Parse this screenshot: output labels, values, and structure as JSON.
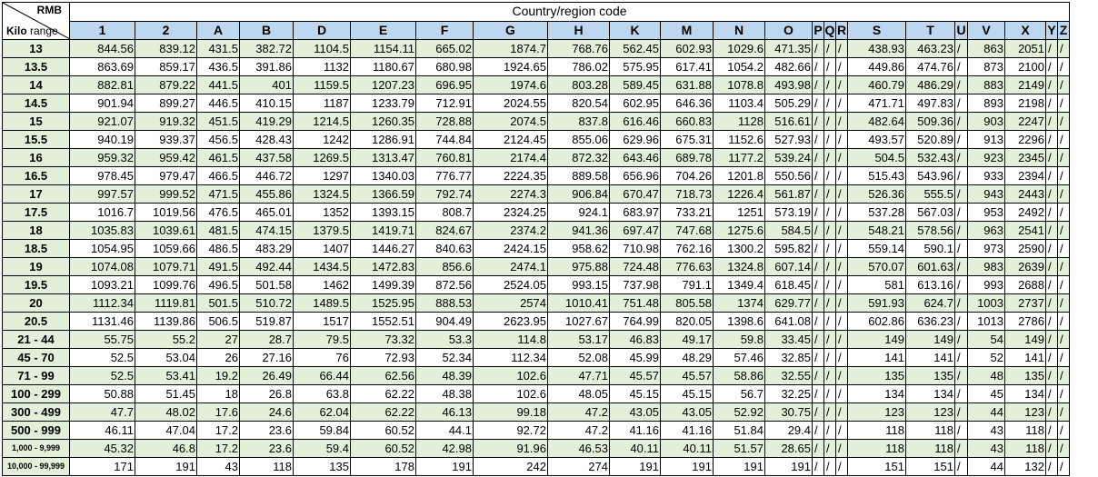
{
  "table": {
    "corner_top": "RMB",
    "corner_bottom_bold": "Kilo",
    "corner_bottom_normal": " range",
    "title": "Country/region code",
    "columns": [
      "1",
      "2",
      "A",
      "B",
      "D",
      "E",
      "F",
      "G",
      "H",
      "K",
      "M",
      "N",
      "O",
      "P",
      "Q",
      "R",
      "S",
      "T",
      "U",
      "V",
      "X",
      "Y",
      "Z"
    ],
    "rows": [
      {
        "label": "13",
        "cells": [
          "844.56",
          "839.12",
          "431.5",
          "382.72",
          "1104.5",
          "1154.11",
          "665.02",
          "1874.7",
          "768.76",
          "562.45",
          "602.93",
          "1029.6",
          "471.35",
          "/",
          "/",
          "/",
          "438.93",
          "463.23",
          "/",
          "863",
          "2051",
          "/",
          "/"
        ]
      },
      {
        "label": "13.5",
        "cells": [
          "863.69",
          "859.17",
          "436.5",
          "391.86",
          "1132",
          "1180.67",
          "680.98",
          "1924.65",
          "786.02",
          "575.95",
          "617.41",
          "1054.2",
          "482.66",
          "/",
          "/",
          "/",
          "449.86",
          "474.76",
          "/",
          "873",
          "2100",
          "/",
          "/"
        ]
      },
      {
        "label": "14",
        "cells": [
          "882.81",
          "879.22",
          "441.5",
          "401",
          "1159.5",
          "1207.23",
          "696.95",
          "1974.6",
          "803.28",
          "589.45",
          "631.88",
          "1078.8",
          "493.98",
          "/",
          "/",
          "/",
          "460.79",
          "486.29",
          "/",
          "883",
          "2149",
          "/",
          "/"
        ]
      },
      {
        "label": "14.5",
        "cells": [
          "901.94",
          "899.27",
          "446.5",
          "410.15",
          "1187",
          "1233.79",
          "712.91",
          "2024.55",
          "820.54",
          "602.95",
          "646.36",
          "1103.4",
          "505.29",
          "/",
          "/",
          "/",
          "471.71",
          "497.83",
          "/",
          "893",
          "2198",
          "/",
          "/"
        ]
      },
      {
        "label": "15",
        "cells": [
          "921.07",
          "919.32",
          "451.5",
          "419.29",
          "1214.5",
          "1260.35",
          "728.88",
          "2074.5",
          "837.8",
          "616.46",
          "660.83",
          "1128",
          "516.61",
          "/",
          "/",
          "/",
          "482.64",
          "509.36",
          "/",
          "903",
          "2247",
          "/",
          "/"
        ]
      },
      {
        "label": "15.5",
        "cells": [
          "940.19",
          "939.37",
          "456.5",
          "428.43",
          "1242",
          "1286.91",
          "744.84",
          "2124.45",
          "855.06",
          "629.96",
          "675.31",
          "1152.6",
          "527.93",
          "/",
          "/",
          "/",
          "493.57",
          "520.89",
          "/",
          "913",
          "2296",
          "/",
          "/"
        ]
      },
      {
        "label": "16",
        "cells": [
          "959.32",
          "959.42",
          "461.5",
          "437.58",
          "1269.5",
          "1313.47",
          "760.81",
          "2174.4",
          "872.32",
          "643.46",
          "689.78",
          "1177.2",
          "539.24",
          "/",
          "/",
          "/",
          "504.5",
          "532.43",
          "/",
          "923",
          "2345",
          "/",
          "/"
        ]
      },
      {
        "label": "16.5",
        "cells": [
          "978.45",
          "979.47",
          "466.5",
          "446.72",
          "1297",
          "1340.03",
          "776.77",
          "2224.35",
          "889.58",
          "656.96",
          "704.26",
          "1201.8",
          "550.56",
          "/",
          "/",
          "/",
          "515.43",
          "543.96",
          "/",
          "933",
          "2394",
          "/",
          "/"
        ]
      },
      {
        "label": "17",
        "cells": [
          "997.57",
          "999.52",
          "471.5",
          "455.86",
          "1324.5",
          "1366.59",
          "792.74",
          "2274.3",
          "906.84",
          "670.47",
          "718.73",
          "1226.4",
          "561.87",
          "/",
          "/",
          "/",
          "526.36",
          "555.5",
          "/",
          "943",
          "2443",
          "/",
          "/"
        ]
      },
      {
        "label": "17.5",
        "cells": [
          "1016.7",
          "1019.56",
          "476.5",
          "465.01",
          "1352",
          "1393.15",
          "808.7",
          "2324.25",
          "924.1",
          "683.97",
          "733.21",
          "1251",
          "573.19",
          "/",
          "/",
          "/",
          "537.28",
          "567.03",
          "/",
          "953",
          "2492",
          "/",
          "/"
        ]
      },
      {
        "label": "18",
        "cells": [
          "1035.83",
          "1039.61",
          "481.5",
          "474.15",
          "1379.5",
          "1419.71",
          "824.67",
          "2374.2",
          "941.36",
          "697.47",
          "747.68",
          "1275.6",
          "584.5",
          "/",
          "/",
          "/",
          "548.21",
          "578.56",
          "/",
          "963",
          "2541",
          "/",
          "/"
        ]
      },
      {
        "label": "18.5",
        "cells": [
          "1054.95",
          "1059.66",
          "486.5",
          "483.29",
          "1407",
          "1446.27",
          "840.63",
          "2424.15",
          "958.62",
          "710.98",
          "762.16",
          "1300.2",
          "595.82",
          "/",
          "/",
          "/",
          "559.14",
          "590.1",
          "/",
          "973",
          "2590",
          "/",
          "/"
        ]
      },
      {
        "label": "19",
        "cells": [
          "1074.08",
          "1079.71",
          "491.5",
          "492.44",
          "1434.5",
          "1472.83",
          "856.6",
          "2474.1",
          "975.88",
          "724.48",
          "776.63",
          "1324.8",
          "607.14",
          "/",
          "/",
          "/",
          "570.07",
          "601.63",
          "/",
          "983",
          "2639",
          "/",
          "/"
        ]
      },
      {
        "label": "19.5",
        "cells": [
          "1093.21",
          "1099.76",
          "496.5",
          "501.58",
          "1462",
          "1499.39",
          "872.56",
          "2524.05",
          "993.15",
          "737.98",
          "791.1",
          "1349.4",
          "618.45",
          "/",
          "/",
          "/",
          "581",
          "613.16",
          "/",
          "993",
          "2688",
          "/",
          "/"
        ]
      },
      {
        "label": "20",
        "cells": [
          "1112.34",
          "1119.81",
          "501.5",
          "510.72",
          "1489.5",
          "1525.95",
          "888.53",
          "2574",
          "1010.41",
          "751.48",
          "805.58",
          "1374",
          "629.77",
          "/",
          "/",
          "/",
          "591.93",
          "624.7",
          "/",
          "1003",
          "2737",
          "/",
          "/"
        ]
      },
      {
        "label": "20.5",
        "cells": [
          "1131.46",
          "1139.86",
          "506.5",
          "519.87",
          "1517",
          "1552.51",
          "904.49",
          "2623.95",
          "1027.67",
          "764.99",
          "820.05",
          "1398.6",
          "641.08",
          "/",
          "/",
          "/",
          "602.86",
          "636.23",
          "/",
          "1013",
          "2786",
          "/",
          "/"
        ]
      },
      {
        "label": "21 - 44",
        "cells": [
          "55.75",
          "55.2",
          "27",
          "28.7",
          "79.5",
          "73.32",
          "53.3",
          "114.8",
          "53.17",
          "46.83",
          "49.17",
          "59.8",
          "33.45",
          "/",
          "/",
          "/",
          "149",
          "149",
          "/",
          "54",
          "149",
          "/",
          "/"
        ]
      },
      {
        "label": "45 - 70",
        "cells": [
          "52.5",
          "53.04",
          "26",
          "27.16",
          "76",
          "72.93",
          "52.34",
          "112.34",
          "52.08",
          "45.99",
          "48.29",
          "57.46",
          "32.85",
          "/",
          "/",
          "/",
          "141",
          "141",
          "/",
          "52",
          "141",
          "/",
          "/"
        ]
      },
      {
        "label": "71 - 99",
        "cells": [
          "52.5",
          "53.41",
          "19.2",
          "26.49",
          "66.44",
          "62.56",
          "48.39",
          "102.6",
          "47.71",
          "45.57",
          "45.57",
          "58.86",
          "32.55",
          "/",
          "/",
          "/",
          "135",
          "135",
          "/",
          "48",
          "135",
          "/",
          "/"
        ]
      },
      {
        "label": "100 - 299",
        "cells": [
          "50.88",
          "51.45",
          "18",
          "26.8",
          "63.8",
          "62.22",
          "48.38",
          "102.6",
          "48.05",
          "45.15",
          "45.15",
          "56.7",
          "32.25",
          "/",
          "/",
          "/",
          "134",
          "134",
          "/",
          "45",
          "134",
          "/",
          "/"
        ]
      },
      {
        "label": "300 - 499",
        "cells": [
          "47.7",
          "48.02",
          "17.6",
          "24.6",
          "62.04",
          "62.22",
          "46.13",
          "99.18",
          "47.2",
          "43.05",
          "43.05",
          "52.92",
          "30.75",
          "/",
          "/",
          "/",
          "123",
          "123",
          "/",
          "44",
          "123",
          "/",
          "/"
        ]
      },
      {
        "label": "500 - 999",
        "cells": [
          "46.11",
          "47.04",
          "17.2",
          "23.6",
          "59.84",
          "60.52",
          "44.1",
          "92.72",
          "47.2",
          "41.16",
          "41.16",
          "51.84",
          "29.4",
          "/",
          "/",
          "/",
          "118",
          "118",
          "/",
          "43",
          "118",
          "/",
          "/"
        ]
      },
      {
        "label": "1,000 - 9,999",
        "cells": [
          "45.32",
          "46.8",
          "17.2",
          "23.6",
          "59.4",
          "60.52",
          "42.98",
          "91.96",
          "46.53",
          "40.11",
          "40.11",
          "51.57",
          "28.65",
          "/",
          "/",
          "/",
          "118",
          "118",
          "/",
          "43",
          "118",
          "/",
          "/"
        ]
      },
      {
        "label": "10,000 - 99,999",
        "cells": [
          "171",
          "191",
          "43",
          "118",
          "135",
          "178",
          "191",
          "242",
          "274",
          "191",
          "191",
          "191",
          "191",
          "/",
          "/",
          "/",
          "151",
          "151",
          "/",
          "44",
          "132",
          "/",
          "/"
        ]
      }
    ]
  }
}
